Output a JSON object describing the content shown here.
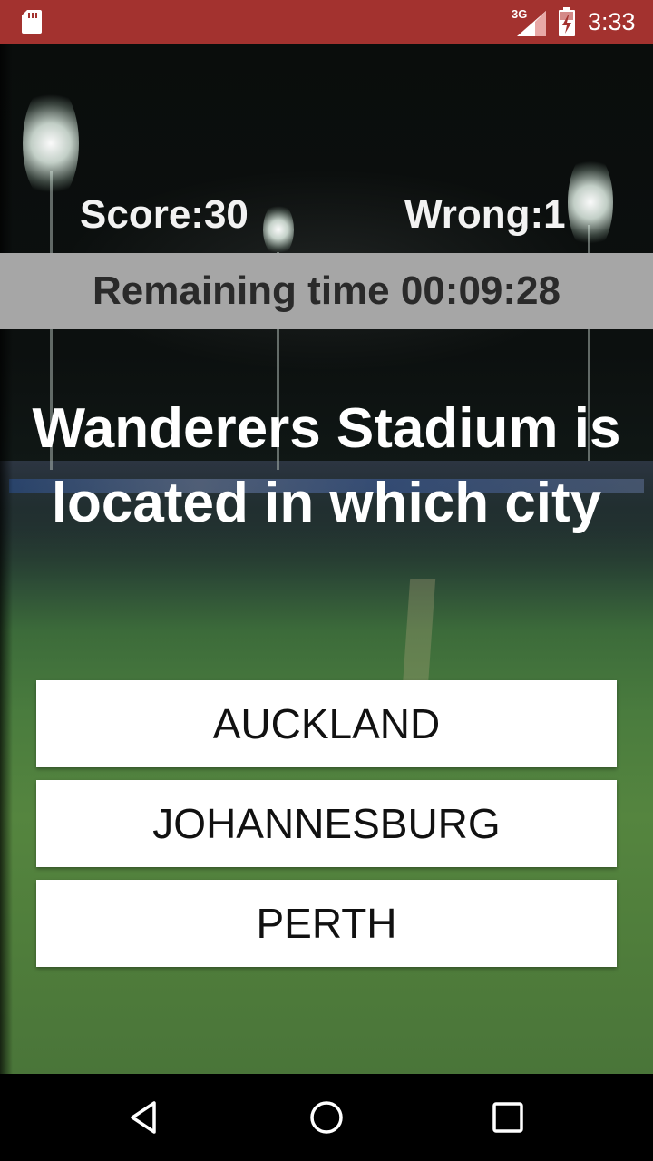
{
  "status_bar": {
    "network_type": "3G",
    "time": "3:33"
  },
  "game": {
    "score_text": "Score:30",
    "wrong_text": "Wrong:1",
    "remaining_time_text": "Remaining time 00:09:28"
  },
  "question": {
    "text": "Wanderers Stadium is located in which city"
  },
  "answers": [
    {
      "label": "AUCKLAND"
    },
    {
      "label": "JOHANNESBURG"
    },
    {
      "label": "PERTH"
    }
  ],
  "nav_bar": {
    "icons": [
      "back-icon",
      "home-icon",
      "recents-icon"
    ]
  },
  "colors": {
    "status_bar": "#a3322f",
    "timer_bar": "#a6a6a6",
    "answer_bg": "#ffffff"
  }
}
